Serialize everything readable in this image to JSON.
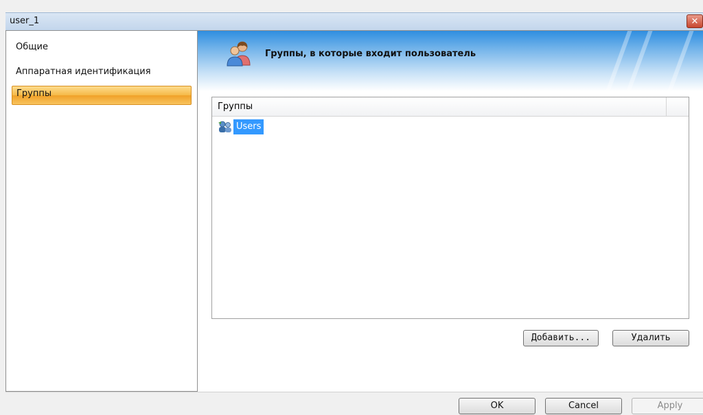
{
  "window": {
    "title": "user_1",
    "close_label": "✕"
  },
  "sidebar": {
    "items": [
      {
        "label": "Общие",
        "selected": false
      },
      {
        "label": "Аппаратная идентификация",
        "selected": false
      },
      {
        "label": "Группы",
        "selected": true
      }
    ]
  },
  "banner": {
    "text": "Группы, в которые входит пользователь",
    "icon": "users-group-icon"
  },
  "group_list": {
    "column_header": "Группы",
    "rows": [
      {
        "label": "Users",
        "icon": "group-icon",
        "selected": true
      }
    ]
  },
  "actions": {
    "add_label": "Добавить...",
    "remove_label": "Удалить"
  },
  "footer": {
    "ok_label": "OK",
    "cancel_label": "Cancel",
    "apply_label": "Apply",
    "apply_enabled": false
  },
  "colors": {
    "selection_blue": "#3399ff",
    "nav_selected": "#f6b947",
    "banner_blue": "#2f8ee0"
  }
}
